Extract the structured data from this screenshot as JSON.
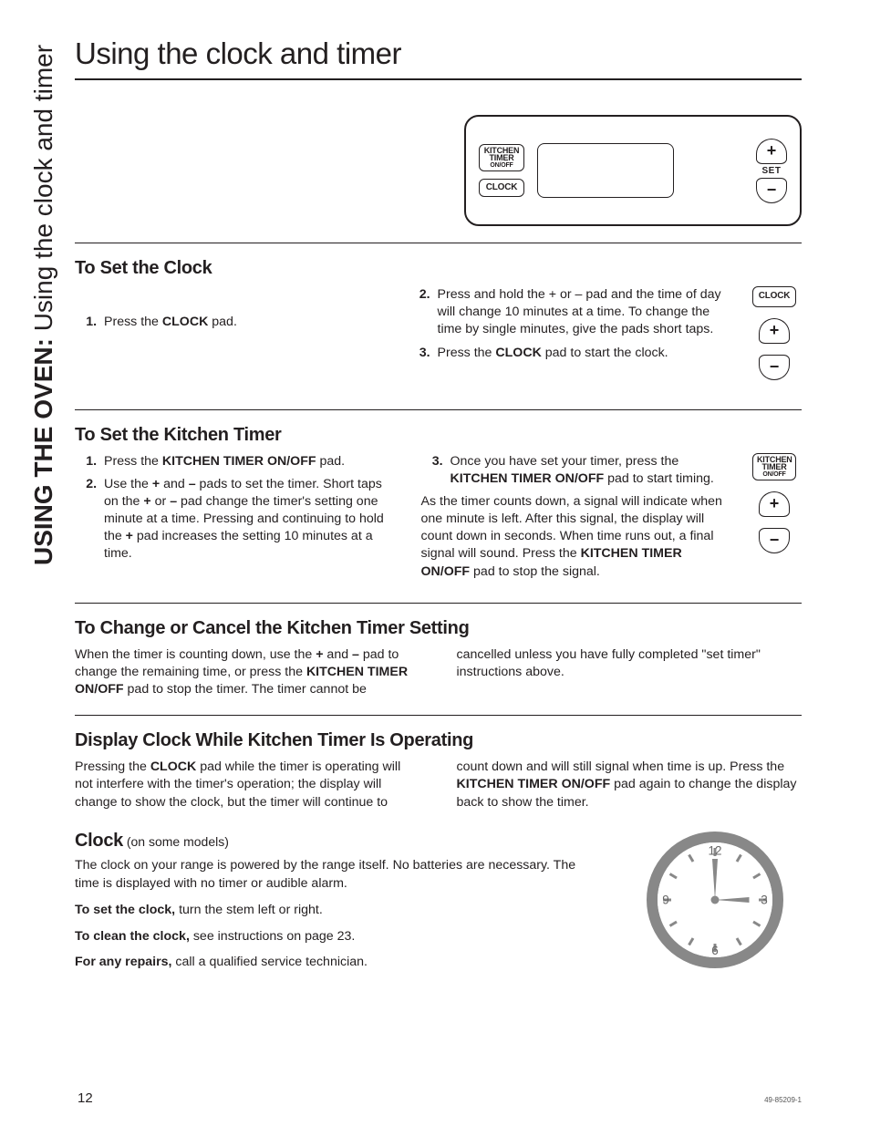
{
  "vtab": {
    "bold": "USING THE OVEN: ",
    "light": "Using the clock and timer"
  },
  "title": "Using the clock and timer",
  "panel": {
    "kitchen_timer_label": "KITCHEN\nTIMER",
    "kitchen_timer_sub": "ON/OFF",
    "clock_label": "CLOCK",
    "set_label": "SET",
    "plus": "+",
    "minus": "−"
  },
  "set_clock": {
    "heading": "To Set the Clock",
    "steps": [
      "Press the <b>CLOCK</b> pad.",
      "Press and hold the + or – pad and the time of day will change 10 minutes at a time. To change the time by single minutes, give the pads short taps.",
      "Press the <b>CLOCK</b> pad to start the clock."
    ],
    "side": {
      "clock": "CLOCK",
      "plus": "+",
      "minus": "−"
    }
  },
  "set_timer": {
    "heading": "To Set the Kitchen Timer",
    "steps": [
      "Press the <b>KITCHEN TIMER ON/OFF</b> pad.",
      "Use the <b>+</b> and <b>–</b> pads to set the timer. Short taps on the <b>+</b> or <b>–</b> pad change the timer's setting one minute at a time. Pressing and continuing to hold the <b>+</b> pad increases the setting 10 minutes at a time.",
      "Once you have set your timer, press the <b>KITCHEN TIMER ON/OFF</b> pad to start timing."
    ],
    "trail": "As the timer counts down, a signal will indicate when one minute is left. After this signal, the display will count down in seconds. When time runs out, a final signal will sound. Press the <b>KITCHEN TIMER ON/OFF</b> pad to stop the signal.",
    "side": {
      "kt": "KITCHEN\nTIMER",
      "kt_sub": "ON/OFF",
      "plus": "+",
      "minus": "−"
    }
  },
  "change_cancel": {
    "heading": "To Change or Cancel the Kitchen Timer Setting",
    "body": "When the timer is counting down, use the <b>+</b> and <b>–</b> pad to change the remaining time, or press the <b>KITCHEN TIMER ON/OFF</b> pad to stop the timer. The timer cannot be cancelled unless you have fully completed \"set timer\" instructions above."
  },
  "display_while": {
    "heading": "Display Clock While Kitchen Timer Is Operating",
    "body": "Pressing the <b>CLOCK</b> pad while the timer is operating will not interfere with the timer's operation; the display will change to show the clock, but the timer will continue to count down and will still signal when time is up. Press the <b>KITCHEN TIMER ON/OFF</b> pad again to change the display back to show the timer."
  },
  "clock_models": {
    "heading": "Clock",
    "sub": " (on some models)",
    "p1": "The clock on your range is powered by the range itself. No batteries are necessary. The time is displayed with no timer or audible alarm.",
    "p2a": "To set the clock,",
    "p2b": " turn the stem left or right.",
    "p3a": "To clean the clock,",
    "p3b": " see instructions on page 23.",
    "p4a": "For any repairs,",
    "p4b": " call a qualified service technician.",
    "face": {
      "n12": "12",
      "n3": "3",
      "n6": "6",
      "n9": "9"
    }
  },
  "footer": {
    "page": "12",
    "docnum": "49-85209-1"
  }
}
